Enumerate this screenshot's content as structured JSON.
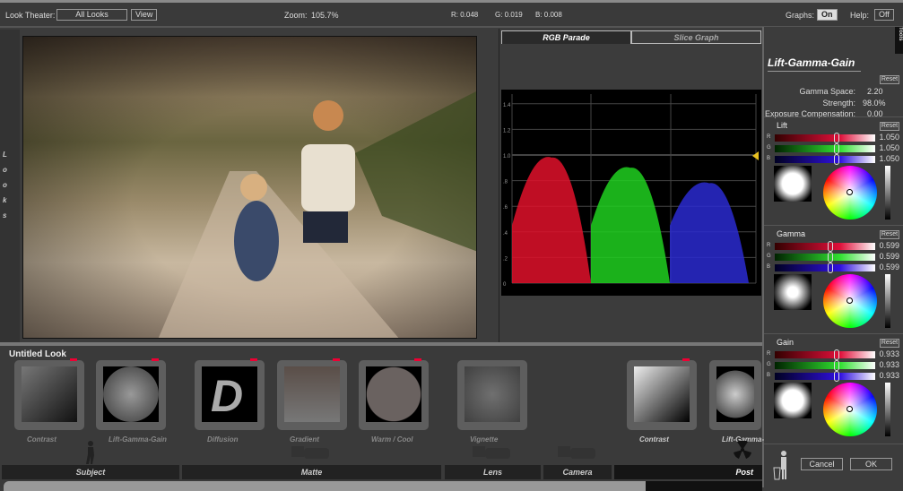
{
  "topbar": {
    "look_theater_label": "Look Theater:",
    "look_theater_value": "All Looks",
    "view_button": "View",
    "zoom_label": "Zoom:",
    "zoom_value": "105.7%",
    "r": "R: 0.048",
    "g": "G: 0.019",
    "b": "B: 0.008",
    "graphs_label": "Graphs:",
    "graphs_value": "On",
    "help_label": "Help:",
    "help_value": "Off"
  },
  "looks_strip": [
    "L",
    "o",
    "o",
    "k",
    "s"
  ],
  "scope": {
    "tabs": [
      {
        "label": "RGB Parade",
        "active": true
      },
      {
        "label": "Slice Graph",
        "active": false
      }
    ],
    "y_ticks": [
      "1.4",
      "1.2",
      "1.0",
      ".8",
      ".6",
      ".4",
      ".2",
      "0"
    ],
    "colors": {
      "red": "#e0102a",
      "green": "#20d020",
      "blue": "#2a2ad0"
    }
  },
  "tools_tab": "Tools",
  "panel": {
    "title": "Lift-Gamma-Gain",
    "reset": "Reset",
    "gamma_space_label": "Gamma Space:",
    "gamma_space": "2.20",
    "strength_label": "Strength:",
    "strength": "98.0%",
    "exposure_label": "Exposure Compensation:",
    "exposure": "0.00",
    "sections": [
      {
        "name": "Lift",
        "r": "1.050",
        "g": "1.050",
        "b": "1.050",
        "thumb": 0.62
      },
      {
        "name": "Gamma",
        "r": "0.599",
        "g": "0.599",
        "b": "0.599",
        "thumb": 0.55
      },
      {
        "name": "Gain",
        "r": "0.933",
        "g": "0.933",
        "b": "0.933",
        "thumb": 0.62
      }
    ],
    "channel_labels": [
      "R",
      "G",
      "B"
    ],
    "cancel": "Cancel",
    "ok": "OK"
  },
  "look": {
    "title": "Untitled Look",
    "tiles": [
      "Contrast",
      "Lift-Gamma-Gain",
      "Diffusion",
      "Gradient",
      "Warm / Cool",
      "Vignette",
      "Contrast",
      "Lift-Gamma-"
    ],
    "categories": [
      "Subject",
      "Matte",
      "Lens",
      "Camera",
      "Post"
    ]
  }
}
